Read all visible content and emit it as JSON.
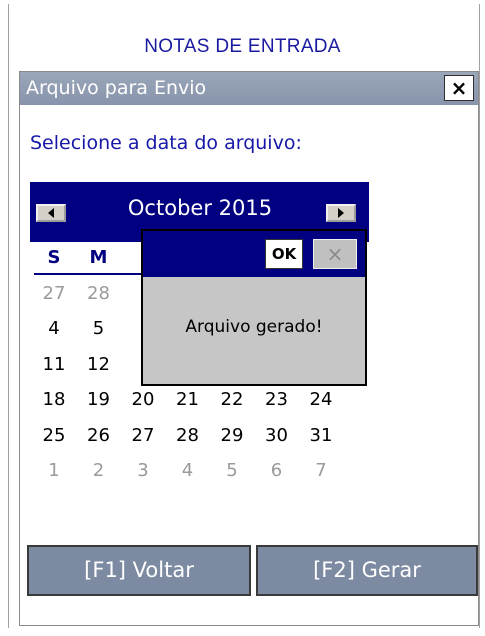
{
  "app": {
    "title": "NOTAS DE ENTRADA"
  },
  "dialog": {
    "title": "Arquivo para Envio",
    "close_label": "×",
    "prompt": "Selecione a data do arquivo:"
  },
  "calendar": {
    "month_label": "October 2015",
    "weekday_headers": [
      "S",
      "M"
    ],
    "rows": [
      [
        {
          "d": "27",
          "dim": true
        },
        {
          "d": "28",
          "dim": true
        }
      ],
      [
        {
          "d": "4"
        },
        {
          "d": "5"
        }
      ],
      [
        {
          "d": "11"
        },
        {
          "d": "12"
        }
      ],
      [
        {
          "d": "18"
        },
        {
          "d": "19"
        },
        {
          "d": "20"
        },
        {
          "d": "21"
        },
        {
          "d": "22"
        },
        {
          "d": "23"
        },
        {
          "d": "24"
        }
      ],
      [
        {
          "d": "25"
        },
        {
          "d": "26"
        },
        {
          "d": "27"
        },
        {
          "d": "28"
        },
        {
          "d": "29"
        },
        {
          "d": "30"
        },
        {
          "d": "31"
        }
      ],
      [
        {
          "d": "1",
          "dim": true
        },
        {
          "d": "2",
          "dim": true
        },
        {
          "d": "3",
          "dim": true
        },
        {
          "d": "4",
          "dim": true
        },
        {
          "d": "5",
          "dim": true
        },
        {
          "d": "6",
          "dim": true
        },
        {
          "d": "7",
          "dim": true
        }
      ]
    ]
  },
  "message_box": {
    "ok_label": "OK",
    "close_label": "×",
    "text": "Arquivo gerado!"
  },
  "buttons": {
    "back_label": "[F1] Voltar",
    "generate_label": "[F2] Gerar"
  }
}
